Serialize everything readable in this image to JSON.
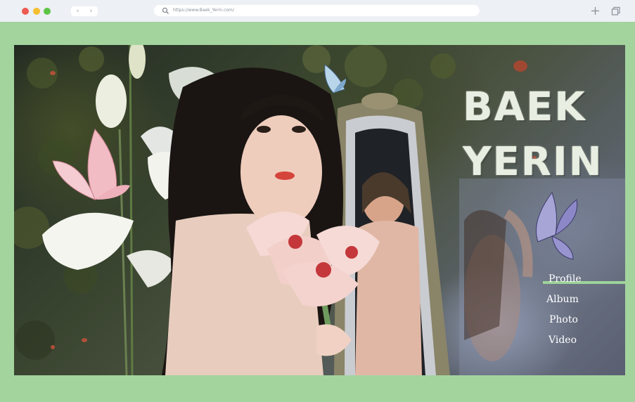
{
  "browser": {
    "url": "https://www.Baek_Yerin.com/",
    "back_icon": "chevron-left",
    "forward_icon": "chevron-right",
    "new_tab_icon": "plus",
    "tabs_icon": "duplicate-windows"
  },
  "hero": {
    "title_line1": "BAEK",
    "title_line2": "YERIN"
  },
  "nav": {
    "items": [
      "Profile",
      "Album",
      "Photo",
      "Video"
    ],
    "active_index": 0
  },
  "colors": {
    "page_background": "#a3d49e",
    "highlight": "#9dd39a",
    "title": "#e9eee2"
  }
}
